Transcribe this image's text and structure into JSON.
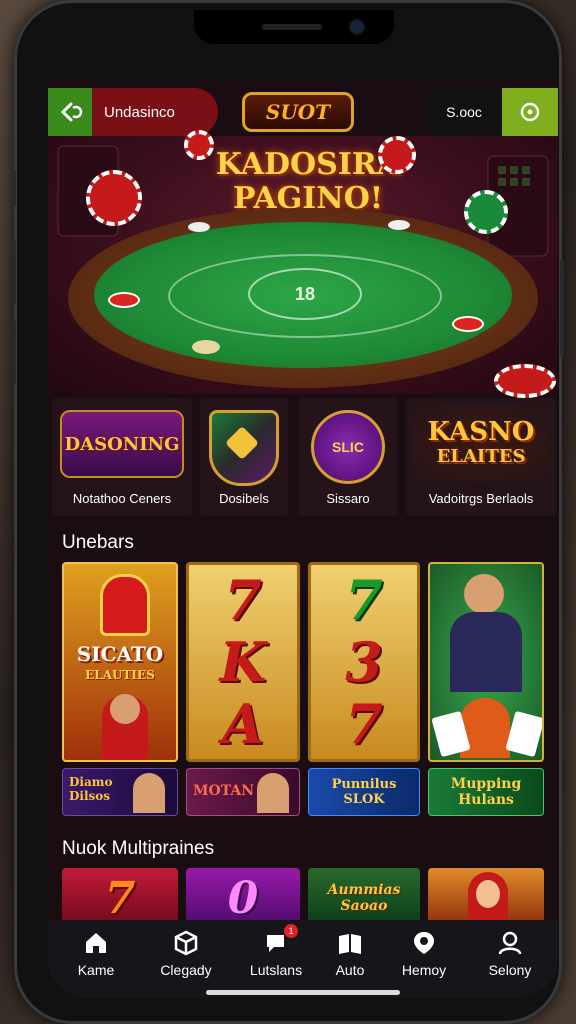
{
  "topbar": {
    "brand": "Undasinco",
    "center_badge": "SUOT",
    "balance": "S.ooc"
  },
  "hero": {
    "title_line1": "KADOSIRA",
    "title_line2": "PAGINO!",
    "table_number": "18"
  },
  "categories": [
    {
      "art": "DASONING",
      "label": "Notathoo Ceners"
    },
    {
      "art": "",
      "label": "Dosibels"
    },
    {
      "art": "SLIC",
      "label": "Sissaro"
    },
    {
      "art_line1": "KASNO",
      "art_line2": "ELAITES",
      "label": "Vadoitrgs Berlaols"
    }
  ],
  "section1": {
    "title": "Unebars",
    "tile1_line1": "SICATO",
    "tile1_line2": "ELAUTIES",
    "reel2": [
      "7",
      "K",
      "A"
    ],
    "reel3": [
      "7",
      "3",
      "7"
    ],
    "banners": [
      "Diamo Dilsos",
      "MOTAN",
      "Punnilus SLOK",
      "Mupping Hulans"
    ]
  },
  "section2": {
    "title": "Nuok Multipraines",
    "tiles": [
      "7",
      "0",
      "Aummias Saoao",
      ""
    ]
  },
  "nav": [
    {
      "icon": "home-icon",
      "label": "Kame"
    },
    {
      "icon": "cube-icon",
      "label": "Clegady"
    },
    {
      "icon": "chat-icon",
      "label": "Lutslans",
      "badge": "1"
    },
    {
      "icon": "book-icon",
      "label": "Auto"
    },
    {
      "icon": "location-icon",
      "label": "Hemoy"
    },
    {
      "icon": "person-icon",
      "label": "Selony"
    }
  ]
}
